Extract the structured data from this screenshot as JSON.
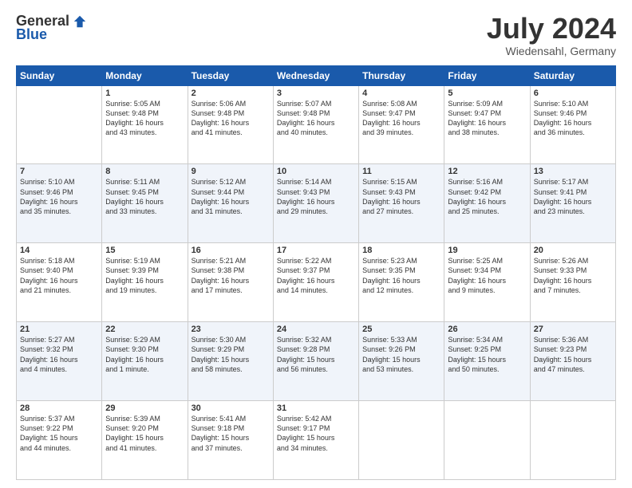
{
  "logo": {
    "general": "General",
    "blue": "Blue"
  },
  "header": {
    "title": "July 2024",
    "subtitle": "Wiedensahl, Germany"
  },
  "days_of_week": [
    "Sunday",
    "Monday",
    "Tuesday",
    "Wednesday",
    "Thursday",
    "Friday",
    "Saturday"
  ],
  "weeks": [
    [
      {
        "day": "",
        "info": ""
      },
      {
        "day": "1",
        "info": "Sunrise: 5:05 AM\nSunset: 9:48 PM\nDaylight: 16 hours\nand 43 minutes."
      },
      {
        "day": "2",
        "info": "Sunrise: 5:06 AM\nSunset: 9:48 PM\nDaylight: 16 hours\nand 41 minutes."
      },
      {
        "day": "3",
        "info": "Sunrise: 5:07 AM\nSunset: 9:48 PM\nDaylight: 16 hours\nand 40 minutes."
      },
      {
        "day": "4",
        "info": "Sunrise: 5:08 AM\nSunset: 9:47 PM\nDaylight: 16 hours\nand 39 minutes."
      },
      {
        "day": "5",
        "info": "Sunrise: 5:09 AM\nSunset: 9:47 PM\nDaylight: 16 hours\nand 38 minutes."
      },
      {
        "day": "6",
        "info": "Sunrise: 5:10 AM\nSunset: 9:46 PM\nDaylight: 16 hours\nand 36 minutes."
      }
    ],
    [
      {
        "day": "7",
        "info": "Sunrise: 5:10 AM\nSunset: 9:46 PM\nDaylight: 16 hours\nand 35 minutes."
      },
      {
        "day": "8",
        "info": "Sunrise: 5:11 AM\nSunset: 9:45 PM\nDaylight: 16 hours\nand 33 minutes."
      },
      {
        "day": "9",
        "info": "Sunrise: 5:12 AM\nSunset: 9:44 PM\nDaylight: 16 hours\nand 31 minutes."
      },
      {
        "day": "10",
        "info": "Sunrise: 5:14 AM\nSunset: 9:43 PM\nDaylight: 16 hours\nand 29 minutes."
      },
      {
        "day": "11",
        "info": "Sunrise: 5:15 AM\nSunset: 9:43 PM\nDaylight: 16 hours\nand 27 minutes."
      },
      {
        "day": "12",
        "info": "Sunrise: 5:16 AM\nSunset: 9:42 PM\nDaylight: 16 hours\nand 25 minutes."
      },
      {
        "day": "13",
        "info": "Sunrise: 5:17 AM\nSunset: 9:41 PM\nDaylight: 16 hours\nand 23 minutes."
      }
    ],
    [
      {
        "day": "14",
        "info": "Sunrise: 5:18 AM\nSunset: 9:40 PM\nDaylight: 16 hours\nand 21 minutes."
      },
      {
        "day": "15",
        "info": "Sunrise: 5:19 AM\nSunset: 9:39 PM\nDaylight: 16 hours\nand 19 minutes."
      },
      {
        "day": "16",
        "info": "Sunrise: 5:21 AM\nSunset: 9:38 PM\nDaylight: 16 hours\nand 17 minutes."
      },
      {
        "day": "17",
        "info": "Sunrise: 5:22 AM\nSunset: 9:37 PM\nDaylight: 16 hours\nand 14 minutes."
      },
      {
        "day": "18",
        "info": "Sunrise: 5:23 AM\nSunset: 9:35 PM\nDaylight: 16 hours\nand 12 minutes."
      },
      {
        "day": "19",
        "info": "Sunrise: 5:25 AM\nSunset: 9:34 PM\nDaylight: 16 hours\nand 9 minutes."
      },
      {
        "day": "20",
        "info": "Sunrise: 5:26 AM\nSunset: 9:33 PM\nDaylight: 16 hours\nand 7 minutes."
      }
    ],
    [
      {
        "day": "21",
        "info": "Sunrise: 5:27 AM\nSunset: 9:32 PM\nDaylight: 16 hours\nand 4 minutes."
      },
      {
        "day": "22",
        "info": "Sunrise: 5:29 AM\nSunset: 9:30 PM\nDaylight: 16 hours\nand 1 minute."
      },
      {
        "day": "23",
        "info": "Sunrise: 5:30 AM\nSunset: 9:29 PM\nDaylight: 15 hours\nand 58 minutes."
      },
      {
        "day": "24",
        "info": "Sunrise: 5:32 AM\nSunset: 9:28 PM\nDaylight: 15 hours\nand 56 minutes."
      },
      {
        "day": "25",
        "info": "Sunrise: 5:33 AM\nSunset: 9:26 PM\nDaylight: 15 hours\nand 53 minutes."
      },
      {
        "day": "26",
        "info": "Sunrise: 5:34 AM\nSunset: 9:25 PM\nDaylight: 15 hours\nand 50 minutes."
      },
      {
        "day": "27",
        "info": "Sunrise: 5:36 AM\nSunset: 9:23 PM\nDaylight: 15 hours\nand 47 minutes."
      }
    ],
    [
      {
        "day": "28",
        "info": "Sunrise: 5:37 AM\nSunset: 9:22 PM\nDaylight: 15 hours\nand 44 minutes."
      },
      {
        "day": "29",
        "info": "Sunrise: 5:39 AM\nSunset: 9:20 PM\nDaylight: 15 hours\nand 41 minutes."
      },
      {
        "day": "30",
        "info": "Sunrise: 5:41 AM\nSunset: 9:18 PM\nDaylight: 15 hours\nand 37 minutes."
      },
      {
        "day": "31",
        "info": "Sunrise: 5:42 AM\nSunset: 9:17 PM\nDaylight: 15 hours\nand 34 minutes."
      },
      {
        "day": "",
        "info": ""
      },
      {
        "day": "",
        "info": ""
      },
      {
        "day": "",
        "info": ""
      }
    ]
  ]
}
